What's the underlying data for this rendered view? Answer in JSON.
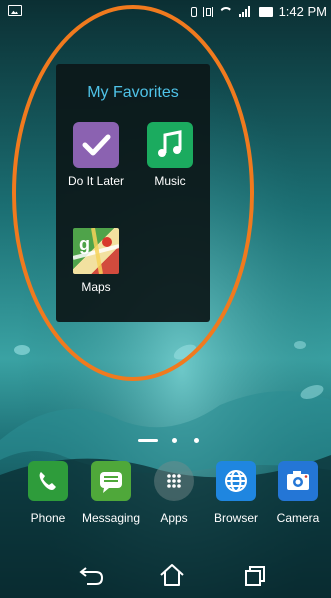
{
  "status_bar": {
    "time": "1:42 PM",
    "icons": [
      "gallery-icon",
      "bluetooth-icon",
      "vibrate-icon",
      "wifi-icon",
      "signal-icon",
      "battery-icon"
    ]
  },
  "folder": {
    "title": "My Favorites",
    "apps": [
      {
        "label": "Do It Later",
        "icon": "checkmark-icon",
        "color": "#8b62b1"
      },
      {
        "label": "Music",
        "icon": "music-note-icon",
        "color": "#1bab5f"
      },
      {
        "label": "Maps",
        "icon": "map-icon",
        "color": "#4fa34a"
      }
    ]
  },
  "dock": {
    "apps": [
      {
        "label": "Phone",
        "icon": "phone-icon",
        "color": "#2e9c3b"
      },
      {
        "label": "Messaging",
        "icon": "message-icon",
        "color": "#4fa83a"
      },
      {
        "label": "Apps",
        "icon": "app-drawer-icon",
        "color": "#6f8c8c"
      },
      {
        "label": "Browser",
        "icon": "globe-icon",
        "color": "#1f86e0"
      },
      {
        "label": "Camera",
        "icon": "camera-icon",
        "color": "#2476d6"
      }
    ]
  },
  "nav": {
    "buttons": [
      "back-icon",
      "home-icon",
      "recent-apps-icon"
    ]
  },
  "colors": {
    "annotation": "#f07a1e",
    "folder_title": "#4fc3e8",
    "wallpaper": "#0e3a3f"
  }
}
